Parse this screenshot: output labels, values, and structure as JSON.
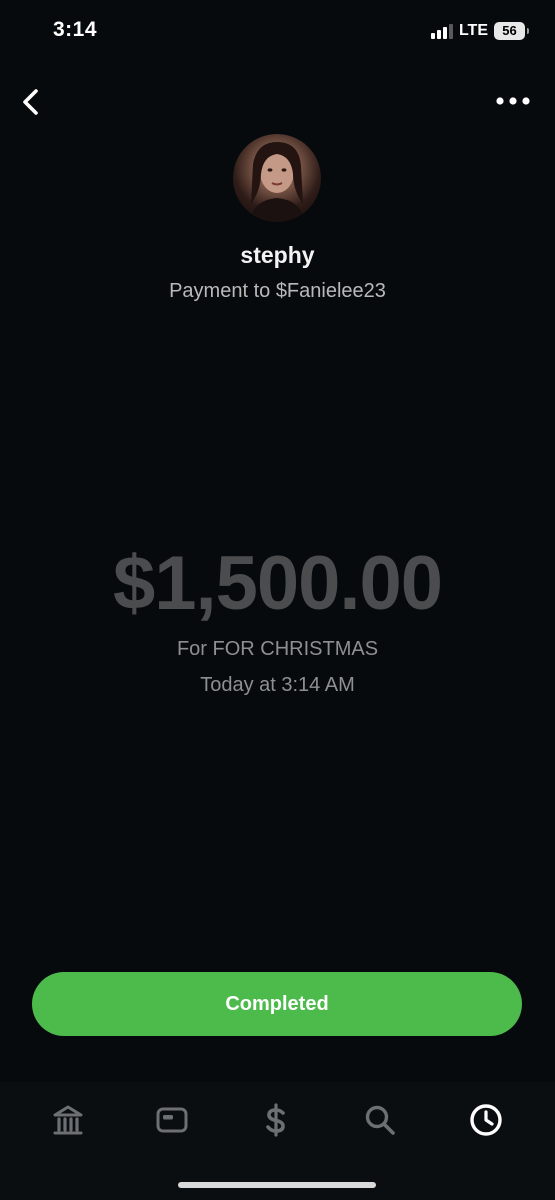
{
  "status_bar": {
    "time": "3:14",
    "network": "LTE",
    "battery": "56"
  },
  "profile": {
    "name": "stephy",
    "subtitle": "Payment to $Fanielee23"
  },
  "payment": {
    "amount": "$1,500.00",
    "note": "For FOR CHRISTMAS",
    "timestamp": "Today at 3:14 AM",
    "status_label": "Completed",
    "status_color": "#4cbb4c"
  },
  "icons": {
    "back": "chevron-left-icon",
    "more": "more-horizontal-icon",
    "tabs": [
      "bank-icon",
      "card-icon",
      "dollar-icon",
      "search-icon",
      "clock-icon"
    ]
  }
}
